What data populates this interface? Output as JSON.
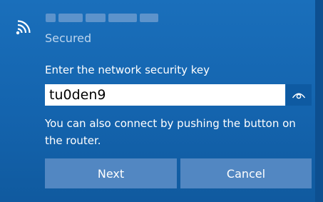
{
  "network": {
    "icon": "wifi-icon",
    "status": "Secured"
  },
  "security_key": {
    "label": "Enter the network security key",
    "value": "tu0den9",
    "reveal_icon": "eye-icon"
  },
  "hint": "You can also connect by pushing the button on the router.",
  "buttons": {
    "next_label": "Next",
    "cancel_label": "Cancel"
  },
  "colors": {
    "panel_background": "#1467b3",
    "button_background": "#5287c2",
    "status_text": "#bcd5ee"
  }
}
